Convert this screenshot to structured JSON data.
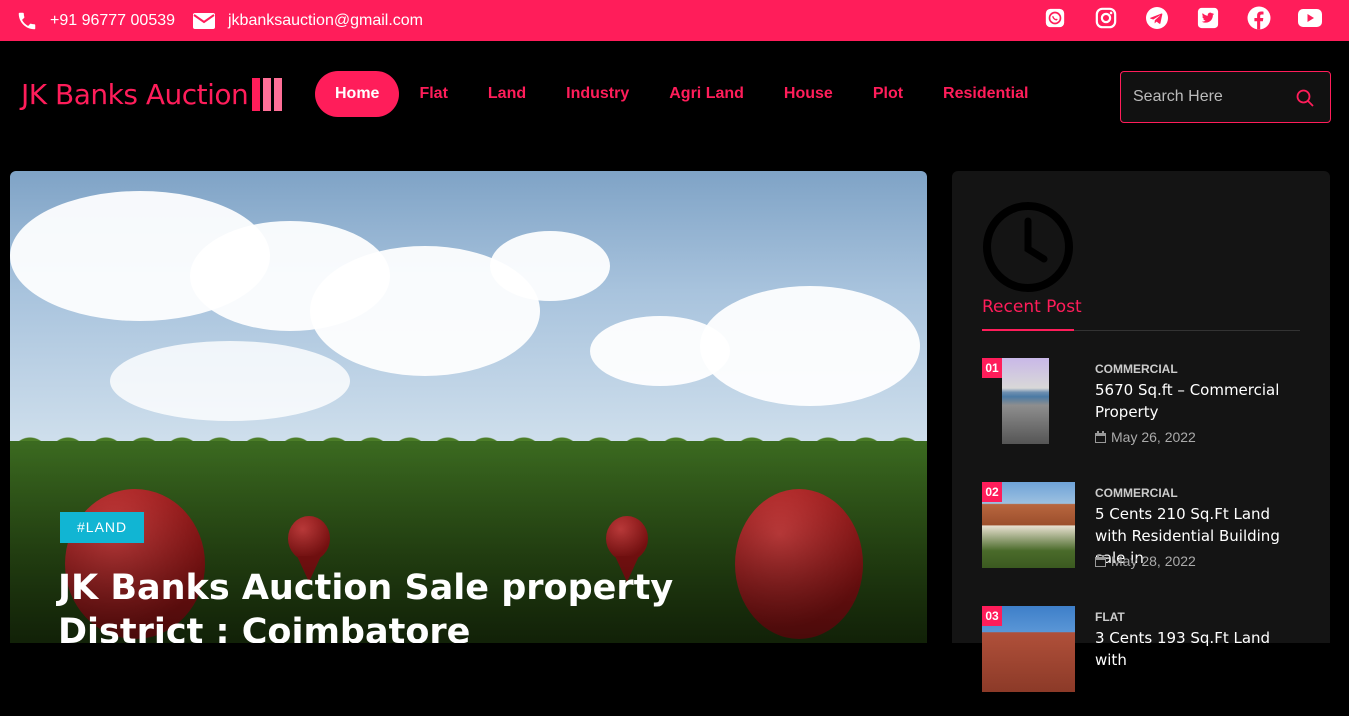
{
  "topbar": {
    "phone": "+91 96777 00539",
    "email": "jkbanksauction@gmail.com",
    "social_icons": [
      "whatsapp-icon",
      "instagram-icon",
      "telegram-icon",
      "twitter-icon",
      "facebook-icon",
      "youtube-icon"
    ]
  },
  "header": {
    "logo": "JK Banks Auction",
    "nav": [
      "Home",
      "Flat",
      "Land",
      "Industry",
      "Agri Land",
      "House",
      "Plot",
      "Residential"
    ],
    "active_nav": "Home",
    "search_placeholder": "Search Here"
  },
  "hero": {
    "tag": "#LAND",
    "title": "JK Banks Auction Sale property District : Coimbatore"
  },
  "sidebar": {
    "title": "Recent Post",
    "posts": [
      {
        "num": "01",
        "category": "COMMERCIAL",
        "title": "5670 Sq.ft – Commercial Property",
        "date": "May 26, 2022"
      },
      {
        "num": "02",
        "category": "COMMERCIAL",
        "title": "5 Cents 210 Sq.Ft Land with Residential Building sale in",
        "date": "May 28, 2022"
      },
      {
        "num": "03",
        "category": "FLAT",
        "title": "3 Cents 193 Sq.Ft Land with",
        "date": ""
      }
    ]
  },
  "colors": {
    "accent": "#ff1d5a",
    "tag": "#11b5d3",
    "background": "#000000"
  }
}
